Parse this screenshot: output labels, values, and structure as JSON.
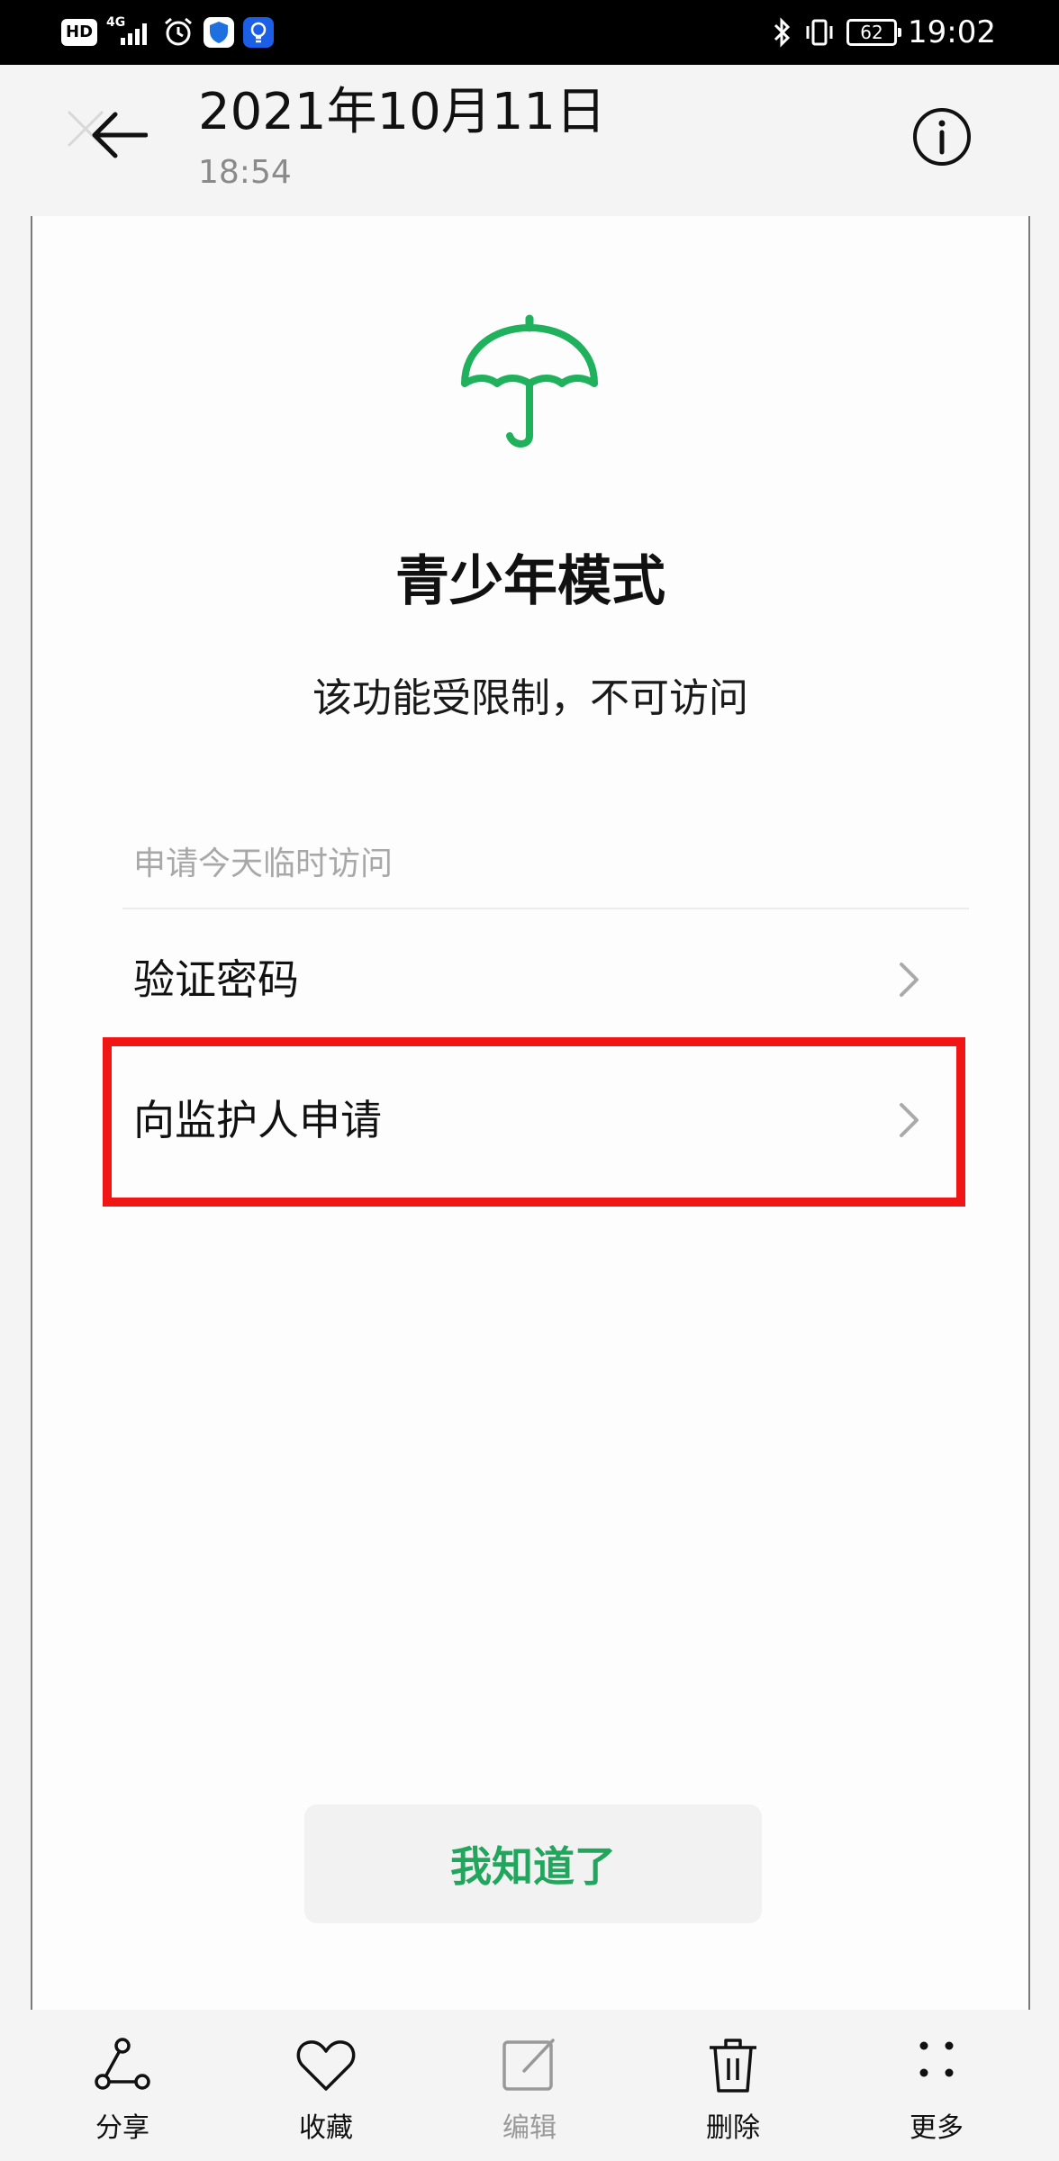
{
  "status_bar": {
    "hd_badge": "HD",
    "network_type": "4G",
    "battery_level": "62",
    "time": "19:02"
  },
  "header": {
    "date": "2021年10月11日",
    "time": "18:54",
    "back_icon": "arrow-left-icon",
    "info_icon": "info-circle-icon"
  },
  "content": {
    "icon": "umbrella-icon",
    "accent_color": "#1fb15c",
    "title": "青少年模式",
    "description": "该功能受限制，不可访问",
    "section_label": "申请今天临时访问",
    "items": [
      {
        "label": "验证密码",
        "icon": "chevron-right-icon"
      },
      {
        "label": "向监护人申请",
        "icon": "chevron-right-icon",
        "highlighted": true
      }
    ],
    "highlight_color": "#f11616",
    "ack_button": "我知道了"
  },
  "toolbar": {
    "items": [
      {
        "label": "分享",
        "icon": "share-icon"
      },
      {
        "label": "收藏",
        "icon": "heart-icon"
      },
      {
        "label": "编辑",
        "icon": "edit-icon",
        "disabled": true
      },
      {
        "label": "删除",
        "icon": "trash-icon"
      },
      {
        "label": "更多",
        "icon": "more-dots-icon"
      }
    ]
  }
}
